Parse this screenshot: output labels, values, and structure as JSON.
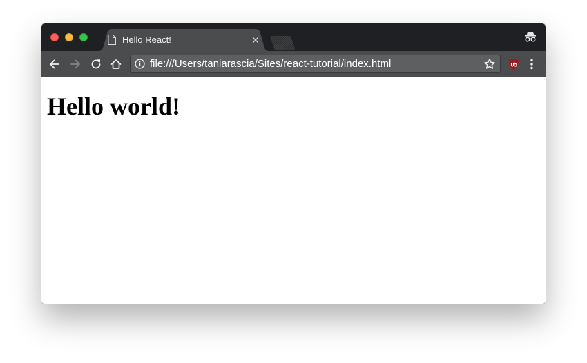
{
  "tab": {
    "title": "Hello React!",
    "icon": "page-icon"
  },
  "toolbar": {
    "url": "file:///Users/taniarascia/Sites/react-tutorial/index.html",
    "icons": [
      "back-icon",
      "forward-icon",
      "reload-icon",
      "home-icon",
      "info-icon",
      "star-icon",
      "ublock-icon",
      "menu-icon"
    ]
  },
  "page": {
    "heading": "Hello world!"
  },
  "colors": {
    "tabstrip": "#1f2023",
    "active_tab": "#4b4c4e",
    "toolbar": "#4b4c4e",
    "omnibox": "#5e5f61",
    "traffic_close": "#fc605c",
    "traffic_minimize": "#fdbc40",
    "traffic_maximize": "#34c84a",
    "ublock": "#9b1c1c"
  }
}
